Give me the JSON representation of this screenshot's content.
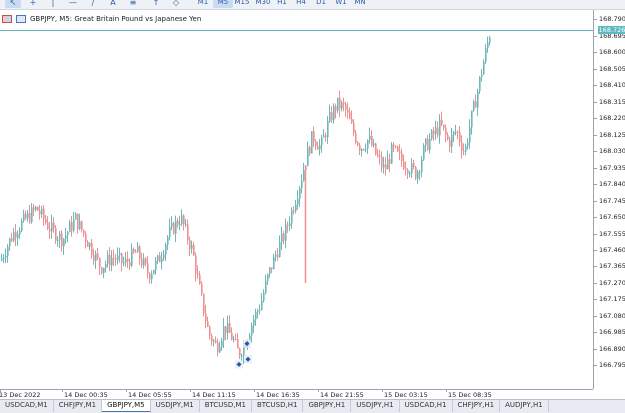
{
  "toolbar": {
    "tools": [
      {
        "icon": "cursor-icon",
        "glyph": "↖",
        "active": true
      },
      {
        "icon": "crosshair-icon",
        "glyph": "+",
        "active": false
      },
      {
        "icon": "vertical-line-icon",
        "glyph": "|",
        "active": false
      },
      {
        "icon": "horizontal-line-icon",
        "glyph": "—",
        "active": false
      },
      {
        "icon": "trendline-icon",
        "glyph": "∕",
        "active": false
      },
      {
        "icon": "text-tool-icon",
        "glyph": "A",
        "active": false
      },
      {
        "icon": "fibonacci-icon",
        "glyph": "≡",
        "active": false
      },
      {
        "icon": "arrow-up-icon",
        "glyph": "↑",
        "active": false
      },
      {
        "icon": "shapes-icon",
        "glyph": "◇",
        "active": false
      }
    ],
    "timeframes": [
      {
        "label": "M1",
        "active": false
      },
      {
        "label": "M5",
        "active": true
      },
      {
        "label": "M15",
        "active": false
      },
      {
        "label": "M30",
        "active": false
      },
      {
        "label": "H1",
        "active": false
      },
      {
        "label": "H4",
        "active": false
      },
      {
        "label": "D1",
        "active": false
      },
      {
        "label": "W1",
        "active": false
      },
      {
        "label": "MN",
        "active": false
      }
    ]
  },
  "chart": {
    "symbol_header": "GBPJPY, M5:  Great Britain Pound vs Japanese Yen",
    "current_price": "168.726",
    "colors": {
      "bull": "#6fb7b9",
      "bear": "#ef8f8f",
      "price_line": "#5fb8be",
      "axis": "#9aa3ad",
      "trade_marker": "#1f57b0"
    }
  },
  "chart_data": {
    "type": "candlestick",
    "symbol": "GBPJPY",
    "timeframe": "M5",
    "ylim": [
      166.71,
      168.775
    ],
    "price_ticks": [
      "168.790",
      "168.695",
      "168.600",
      "168.505",
      "168.410",
      "168.315",
      "168.220",
      "168.125",
      "168.030",
      "167.935",
      "167.840",
      "167.745",
      "167.650",
      "167.555",
      "167.460",
      "167.365",
      "167.270",
      "167.175",
      "167.080",
      "166.985",
      "166.890",
      "166.795"
    ],
    "time_ticks": [
      "13 Dec 2022",
      "14 Dec 00:35",
      "14 Dec 05:55",
      "14 Dec 11:15",
      "14 Dec 16:35",
      "14 Dec 21:55",
      "15 Dec 03:15",
      "15 Dec 08:35"
    ],
    "current_price": 168.726,
    "close_path": [
      [
        0,
        167.4
      ],
      [
        12,
        167.55
      ],
      [
        22,
        167.62
      ],
      [
        36,
        167.7
      ],
      [
        50,
        167.58
      ],
      [
        62,
        167.52
      ],
      [
        75,
        167.64
      ],
      [
        88,
        167.5
      ],
      [
        100,
        167.36
      ],
      [
        112,
        167.42
      ],
      [
        124,
        167.38
      ],
      [
        136,
        167.45
      ],
      [
        148,
        167.32
      ],
      [
        158,
        167.4
      ],
      [
        168,
        167.55
      ],
      [
        180,
        167.65
      ],
      [
        192,
        167.45
      ],
      [
        200,
        167.2
      ],
      [
        208,
        166.98
      ],
      [
        216,
        166.9
      ],
      [
        224,
        167.02
      ],
      [
        232,
        166.95
      ],
      [
        238,
        166.86
      ],
      [
        244,
        166.92
      ],
      [
        252,
        167.05
      ],
      [
        260,
        167.15
      ],
      [
        268,
        167.32
      ],
      [
        276,
        167.45
      ],
      [
        284,
        167.55
      ],
      [
        292,
        167.7
      ],
      [
        300,
        167.86
      ],
      [
        306,
        168.0
      ],
      [
        312,
        168.12
      ],
      [
        320,
        168.05
      ],
      [
        328,
        168.2
      ],
      [
        336,
        168.3
      ],
      [
        344,
        168.28
      ],
      [
        352,
        168.15
      ],
      [
        360,
        168.05
      ],
      [
        368,
        168.1
      ],
      [
        376,
        168.0
      ],
      [
        384,
        167.92
      ],
      [
        392,
        168.04
      ],
      [
        400,
        167.98
      ],
      [
        408,
        167.94
      ],
      [
        416,
        167.9
      ],
      [
        424,
        168.05
      ],
      [
        432,
        168.12
      ],
      [
        440,
        168.18
      ],
      [
        448,
        168.08
      ],
      [
        456,
        168.15
      ],
      [
        464,
        168.02
      ],
      [
        470,
        168.2
      ],
      [
        476,
        168.35
      ],
      [
        482,
        168.52
      ],
      [
        488,
        168.68
      ],
      [
        492,
        168.79
      ]
    ],
    "trades": [
      {
        "kind": "buy-marker"
      },
      {
        "kind": "sell-marker"
      },
      {
        "kind": "buy-marker"
      }
    ]
  },
  "tabs": [
    {
      "label": "USDCAD,M1",
      "active": false
    },
    {
      "label": "CHFJPY,M1",
      "active": false
    },
    {
      "label": "GBPJPY,M5",
      "active": true
    },
    {
      "label": "USDJPY,M1",
      "active": false
    },
    {
      "label": "BTCUSD,M1",
      "active": false
    },
    {
      "label": "BTCUSD,H1",
      "active": false
    },
    {
      "label": "GBPJPY,H1",
      "active": false
    },
    {
      "label": "USDJPY,H1",
      "active": false
    },
    {
      "label": "USDCAD,H1",
      "active": false
    },
    {
      "label": "CHFJPY,H1",
      "active": false
    },
    {
      "label": "AUDJPY,H1",
      "active": false
    }
  ]
}
